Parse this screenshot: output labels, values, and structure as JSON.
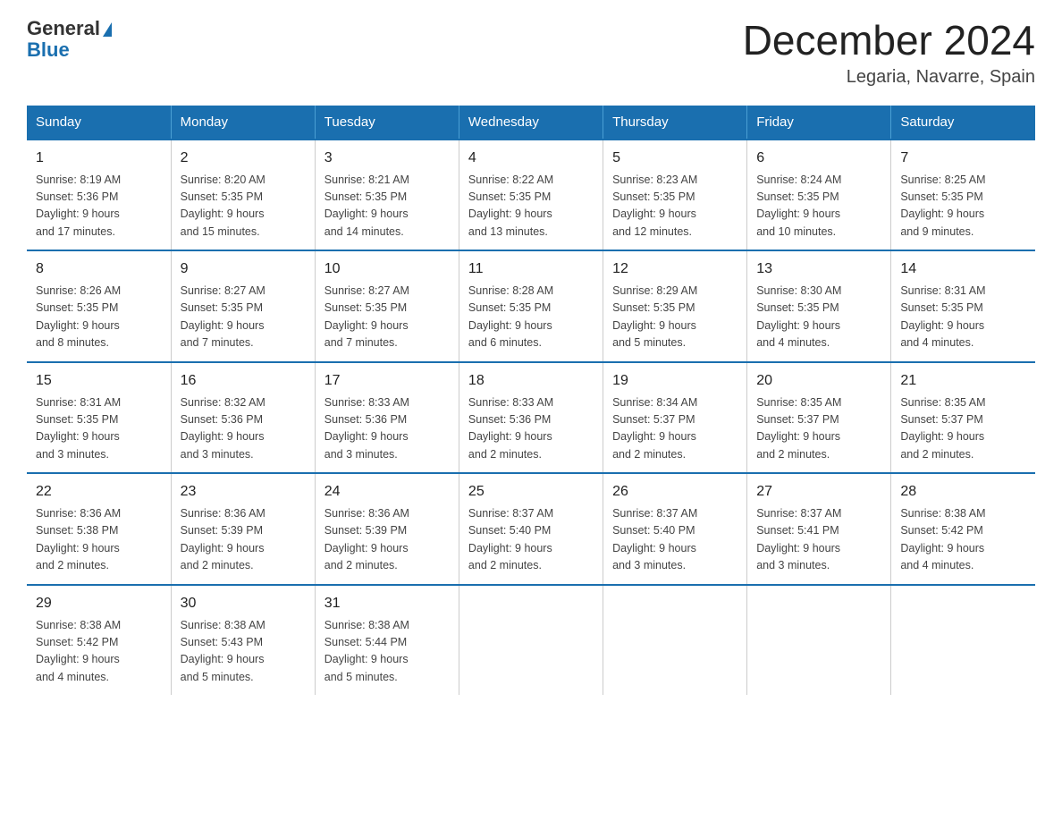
{
  "header": {
    "logo_general": "General",
    "logo_blue": "Blue",
    "title": "December 2024",
    "subtitle": "Legaria, Navarre, Spain"
  },
  "days_of_week": [
    "Sunday",
    "Monday",
    "Tuesday",
    "Wednesday",
    "Thursday",
    "Friday",
    "Saturday"
  ],
  "weeks": [
    [
      {
        "day": "1",
        "sunrise": "8:19 AM",
        "sunset": "5:36 PM",
        "daylight": "9 hours and 17 minutes."
      },
      {
        "day": "2",
        "sunrise": "8:20 AM",
        "sunset": "5:35 PM",
        "daylight": "9 hours and 15 minutes."
      },
      {
        "day": "3",
        "sunrise": "8:21 AM",
        "sunset": "5:35 PM",
        "daylight": "9 hours and 14 minutes."
      },
      {
        "day": "4",
        "sunrise": "8:22 AM",
        "sunset": "5:35 PM",
        "daylight": "9 hours and 13 minutes."
      },
      {
        "day": "5",
        "sunrise": "8:23 AM",
        "sunset": "5:35 PM",
        "daylight": "9 hours and 12 minutes."
      },
      {
        "day": "6",
        "sunrise": "8:24 AM",
        "sunset": "5:35 PM",
        "daylight": "9 hours and 10 minutes."
      },
      {
        "day": "7",
        "sunrise": "8:25 AM",
        "sunset": "5:35 PM",
        "daylight": "9 hours and 9 minutes."
      }
    ],
    [
      {
        "day": "8",
        "sunrise": "8:26 AM",
        "sunset": "5:35 PM",
        "daylight": "9 hours and 8 minutes."
      },
      {
        "day": "9",
        "sunrise": "8:27 AM",
        "sunset": "5:35 PM",
        "daylight": "9 hours and 7 minutes."
      },
      {
        "day": "10",
        "sunrise": "8:27 AM",
        "sunset": "5:35 PM",
        "daylight": "9 hours and 7 minutes."
      },
      {
        "day": "11",
        "sunrise": "8:28 AM",
        "sunset": "5:35 PM",
        "daylight": "9 hours and 6 minutes."
      },
      {
        "day": "12",
        "sunrise": "8:29 AM",
        "sunset": "5:35 PM",
        "daylight": "9 hours and 5 minutes."
      },
      {
        "day": "13",
        "sunrise": "8:30 AM",
        "sunset": "5:35 PM",
        "daylight": "9 hours and 4 minutes."
      },
      {
        "day": "14",
        "sunrise": "8:31 AM",
        "sunset": "5:35 PM",
        "daylight": "9 hours and 4 minutes."
      }
    ],
    [
      {
        "day": "15",
        "sunrise": "8:31 AM",
        "sunset": "5:35 PM",
        "daylight": "9 hours and 3 minutes."
      },
      {
        "day": "16",
        "sunrise": "8:32 AM",
        "sunset": "5:36 PM",
        "daylight": "9 hours and 3 minutes."
      },
      {
        "day": "17",
        "sunrise": "8:33 AM",
        "sunset": "5:36 PM",
        "daylight": "9 hours and 3 minutes."
      },
      {
        "day": "18",
        "sunrise": "8:33 AM",
        "sunset": "5:36 PM",
        "daylight": "9 hours and 2 minutes."
      },
      {
        "day": "19",
        "sunrise": "8:34 AM",
        "sunset": "5:37 PM",
        "daylight": "9 hours and 2 minutes."
      },
      {
        "day": "20",
        "sunrise": "8:35 AM",
        "sunset": "5:37 PM",
        "daylight": "9 hours and 2 minutes."
      },
      {
        "day": "21",
        "sunrise": "8:35 AM",
        "sunset": "5:37 PM",
        "daylight": "9 hours and 2 minutes."
      }
    ],
    [
      {
        "day": "22",
        "sunrise": "8:36 AM",
        "sunset": "5:38 PM",
        "daylight": "9 hours and 2 minutes."
      },
      {
        "day": "23",
        "sunrise": "8:36 AM",
        "sunset": "5:39 PM",
        "daylight": "9 hours and 2 minutes."
      },
      {
        "day": "24",
        "sunrise": "8:36 AM",
        "sunset": "5:39 PM",
        "daylight": "9 hours and 2 minutes."
      },
      {
        "day": "25",
        "sunrise": "8:37 AM",
        "sunset": "5:40 PM",
        "daylight": "9 hours and 2 minutes."
      },
      {
        "day": "26",
        "sunrise": "8:37 AM",
        "sunset": "5:40 PM",
        "daylight": "9 hours and 3 minutes."
      },
      {
        "day": "27",
        "sunrise": "8:37 AM",
        "sunset": "5:41 PM",
        "daylight": "9 hours and 3 minutes."
      },
      {
        "day": "28",
        "sunrise": "8:38 AM",
        "sunset": "5:42 PM",
        "daylight": "9 hours and 4 minutes."
      }
    ],
    [
      {
        "day": "29",
        "sunrise": "8:38 AM",
        "sunset": "5:42 PM",
        "daylight": "9 hours and 4 minutes."
      },
      {
        "day": "30",
        "sunrise": "8:38 AM",
        "sunset": "5:43 PM",
        "daylight": "9 hours and 5 minutes."
      },
      {
        "day": "31",
        "sunrise": "8:38 AM",
        "sunset": "5:44 PM",
        "daylight": "9 hours and 5 minutes."
      },
      null,
      null,
      null,
      null
    ]
  ],
  "labels": {
    "sunrise": "Sunrise:",
    "sunset": "Sunset:",
    "daylight": "Daylight:"
  }
}
